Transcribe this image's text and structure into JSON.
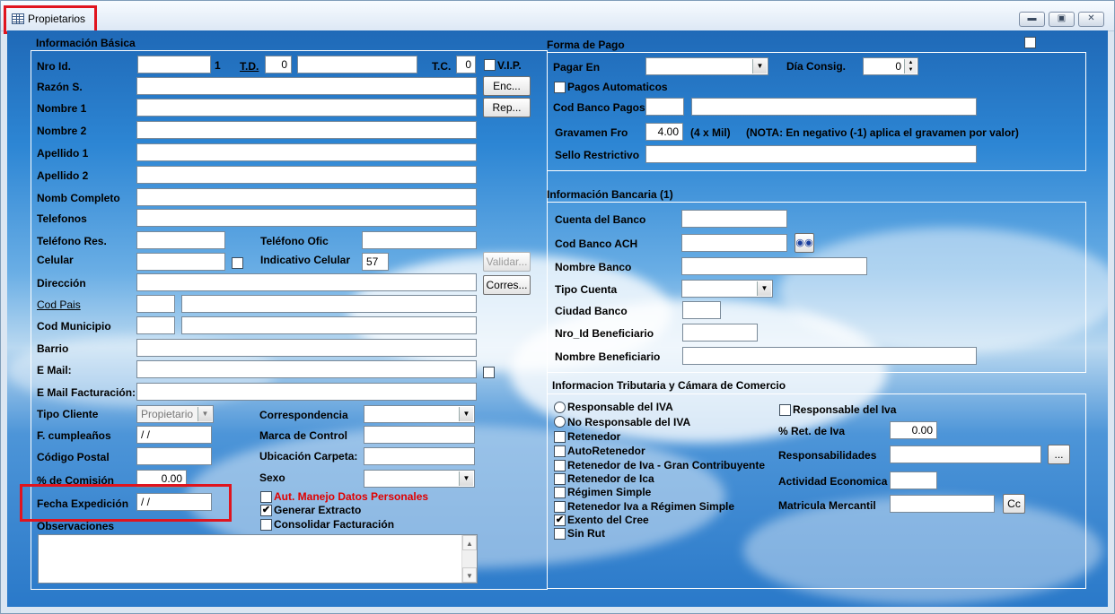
{
  "window": {
    "title": "Propietarios",
    "minimize": "▬",
    "restore": "▣",
    "close": "✕"
  },
  "basic": {
    "section_title": "Información Básica",
    "nro_id_label": "Nro Id.",
    "nro_id_value": "",
    "nro_id_digit": "1",
    "td_label": "T.D.",
    "td_value": "0",
    "td_text": "",
    "tc_label": "T.C.",
    "tc_value": "0",
    "vip_label": "V.I.P.",
    "razon_label": "Razón S.",
    "nombre1_label": "Nombre 1",
    "nombre2_label": "Nombre 2",
    "apellido1_label": "Apellido 1",
    "apellido2_label": "Apellido 2",
    "nomb_completo_label": "Nomb Completo",
    "telefonos_label": "Telefonos",
    "telefono_res_label": "Teléfono Res.",
    "telefono_ofic_label": "Teléfono Ofic",
    "celular_label": "Celular",
    "indicativo_label": "Indicativo Celular",
    "indicativo_value": "57",
    "direccion_label": "Dirección",
    "cod_pais_label": "Cod Pais",
    "cod_municipio_label": "Cod Municipio",
    "barrio_label": "Barrio",
    "email_label": "E Mail:",
    "email_fact_label": "E Mail Facturación:",
    "tipo_cliente_label": "Tipo Cliente",
    "tipo_cliente_value": "Propietario",
    "correspondencia_label": "Correspondencia",
    "cumple_label": "F. cumpleaños",
    "cumple_value": " / /",
    "marca_label": "Marca de Control",
    "postal_label": "Código Postal",
    "ubicacion_label": "Ubicación Carpeta:",
    "comision_label": "% de Comisión",
    "comision_value": "0.00",
    "sexo_label": "Sexo",
    "fecha_exp_label": "Fecha Expedición",
    "fecha_exp_value": " / /",
    "aut_label": "Aut. Manejo Datos Personales",
    "generar_label": "Generar Extracto",
    "consolidar_label": "Consolidar Facturación",
    "observaciones_label": "Observaciones",
    "btn_enc": "Enc...",
    "btn_rep": "Rep...",
    "btn_validar": "Validar...",
    "btn_corres": "Corres..."
  },
  "pago": {
    "section_title": "Forma de Pago",
    "pagar_en_label": "Pagar En",
    "dia_label": "Día Consig.",
    "dia_value": "0",
    "automaticos_label": "Pagos Automaticos",
    "cod_banco_label": "Cod Banco Pagos",
    "gravamen_label": "Gravamen Fro",
    "gravamen_value": "4.00",
    "gravamen_unit": "(4 x Mil)",
    "gravamen_note": "(NOTA: En negativo (-1) aplica el gravamen por valor)",
    "sello_label": "Sello Restrictivo"
  },
  "banco": {
    "section_title": "Información Bancaria (1)",
    "cuenta_label": "Cuenta del Banco",
    "ach_label": "Cod Banco ACH",
    "nombre_label": "Nombre Banco",
    "tipo_label": "Tipo Cuenta",
    "ciudad_label": "Ciudad Banco",
    "nro_benef_label": "Nro_Id Beneficiario",
    "nombre_benef_label": "Nombre Beneficiario"
  },
  "tributaria": {
    "section_title": "Informacion Tributaria y Cámara de Comercio",
    "resp_iva_radio": "Responsable del IVA",
    "no_resp_iva_radio": "No Responsable del IVA",
    "retenedor": "Retenedor",
    "autoretenedor": "AutoRetenedor",
    "ret_gran": "Retenedor de Iva - Gran Contribuyente",
    "ret_ica": "Retenedor de Ica",
    "regimen": "Régimen Simple",
    "ret_regimen": "Retenedor Iva a Régimen Simple",
    "exento": "Exento del Cree",
    "sin_rut": "Sin Rut",
    "resp_iva_chk": "Responsable del Iva",
    "ret_iva_label": "% Ret. de Iva",
    "ret_iva_value": "0.00",
    "responsabilidades_label": "Responsabilidades",
    "btn_dots": "...",
    "actividad_label": "Actividad Economica",
    "matricula_label": "Matricula Mercantil",
    "btn_cc": "Cc"
  }
}
